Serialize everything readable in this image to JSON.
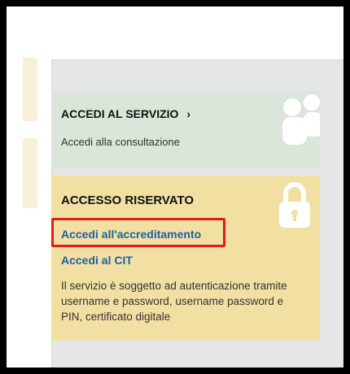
{
  "service_panel": {
    "title": "ACCEDI AL SERVIZIO",
    "chevron": "›",
    "subtitle": "Accedi alla consultazione",
    "icon": "people-icon"
  },
  "reserved_panel": {
    "title": "ACCESSO RISERVATO",
    "icon": "lock-icon",
    "links": {
      "accreditamento": "Accedi all'accreditamento",
      "cit": "Accedi al CIT"
    },
    "description": "Il servizio è soggetto ad autenticazione tramite username e password, username password e PIN, certificato digitale"
  },
  "colors": {
    "service_bg": "#d9e6d9",
    "reserved_bg": "#f2e0a3",
    "link": "#1f5fa3",
    "highlight": "#e31b1b"
  }
}
